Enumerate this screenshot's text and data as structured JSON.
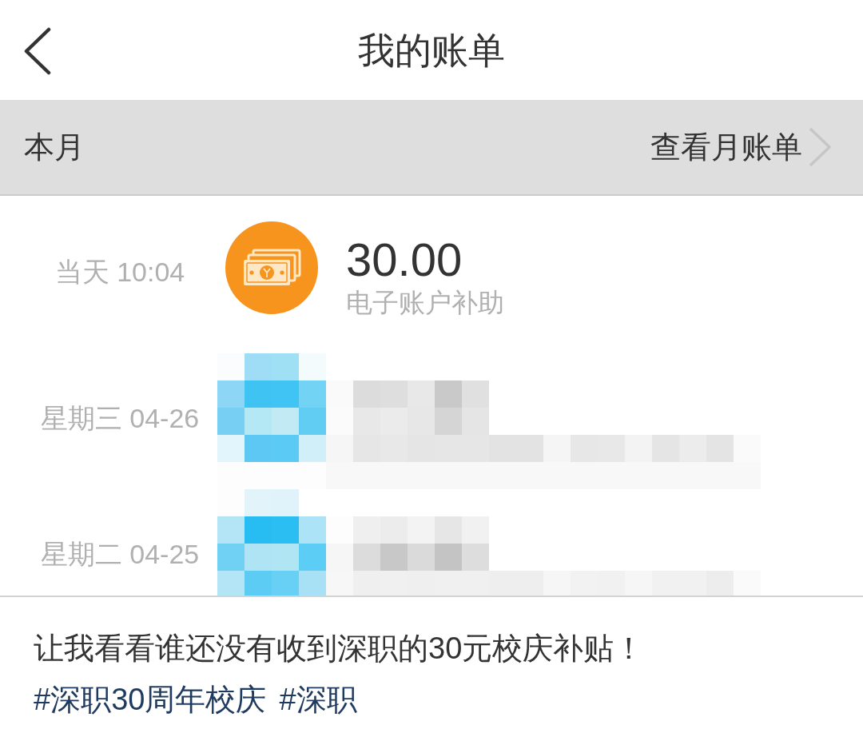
{
  "header": {
    "title": "我的账单"
  },
  "month_bar": {
    "label": "本月",
    "link": "查看月账单"
  },
  "bills": [
    {
      "kind": "entry",
      "time": "当天 10:04",
      "amount": "30.00",
      "description": "电子账户补助"
    },
    {
      "kind": "redacted",
      "time": "星期三 04-26"
    },
    {
      "kind": "redacted",
      "time": "星期二 04-25"
    }
  ],
  "post": {
    "text": "让我看看谁还没有收到深职的30元校庆补贴！",
    "hashtags": [
      "#深职30周年校庆",
      "#深职"
    ]
  }
}
